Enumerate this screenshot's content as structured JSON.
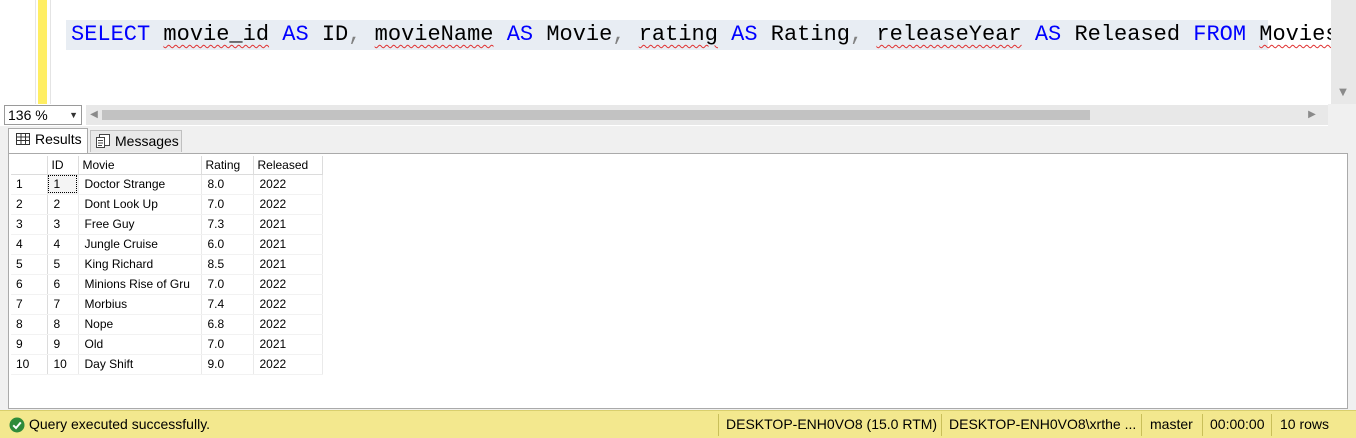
{
  "editor": {
    "sql_tokens": {
      "select": "SELECT",
      "col1": "movie_id",
      "as1": "AS",
      "alias1": "ID",
      "comma1": ",",
      "col2": "movieName",
      "as2": "AS",
      "alias2": "Movie",
      "comma2": ",",
      "col3": "rating",
      "as3": "AS",
      "alias3": "Rating",
      "comma3": ",",
      "col4": "releaseYear",
      "as4": "AS",
      "alias4": "Released",
      "from": "FROM",
      "table": "Movies",
      "semicolon": ";"
    }
  },
  "zoom": {
    "value": "136 %"
  },
  "tabs": {
    "results": "Results",
    "messages": "Messages"
  },
  "grid": {
    "columns": [
      "ID",
      "Movie",
      "Rating",
      "Released"
    ],
    "rows": [
      {
        "n": "1",
        "id": "1",
        "movie": "Doctor Strange",
        "rating": "8.0",
        "released": "2022"
      },
      {
        "n": "2",
        "id": "2",
        "movie": "Dont Look Up",
        "rating": "7.0",
        "released": "2022"
      },
      {
        "n": "3",
        "id": "3",
        "movie": "Free Guy",
        "rating": "7.3",
        "released": "2021"
      },
      {
        "n": "4",
        "id": "4",
        "movie": "Jungle Cruise",
        "rating": "6.0",
        "released": "2021"
      },
      {
        "n": "5",
        "id": "5",
        "movie": "King Richard",
        "rating": "8.5",
        "released": "2021"
      },
      {
        "n": "6",
        "id": "6",
        "movie": "Minions Rise of Gru",
        "rating": "7.0",
        "released": "2022"
      },
      {
        "n": "7",
        "id": "7",
        "movie": "Morbius",
        "rating": "7.4",
        "released": "2022"
      },
      {
        "n": "8",
        "id": "8",
        "movie": "Nope",
        "rating": "6.8",
        "released": "2022"
      },
      {
        "n": "9",
        "id": "9",
        "movie": "Old",
        "rating": "7.0",
        "released": "2021"
      },
      {
        "n": "10",
        "id": "10",
        "movie": "Day Shift",
        "rating": "9.0",
        "released": "2022"
      }
    ]
  },
  "status": {
    "message": "Query executed successfully.",
    "server": "DESKTOP-ENH0VO8 (15.0 RTM)",
    "login": "DESKTOP-ENH0VO8\\xrthe ...",
    "database": "master",
    "elapsed": "00:00:00",
    "rows": "10 rows",
    "icon": "check-circle-icon",
    "color": "#f3e88e"
  },
  "colors": {
    "keyword": "#0000ff",
    "error_squiggle": "#e03030",
    "change_margin": "#ffee62",
    "current_line": "#e8edf3"
  }
}
